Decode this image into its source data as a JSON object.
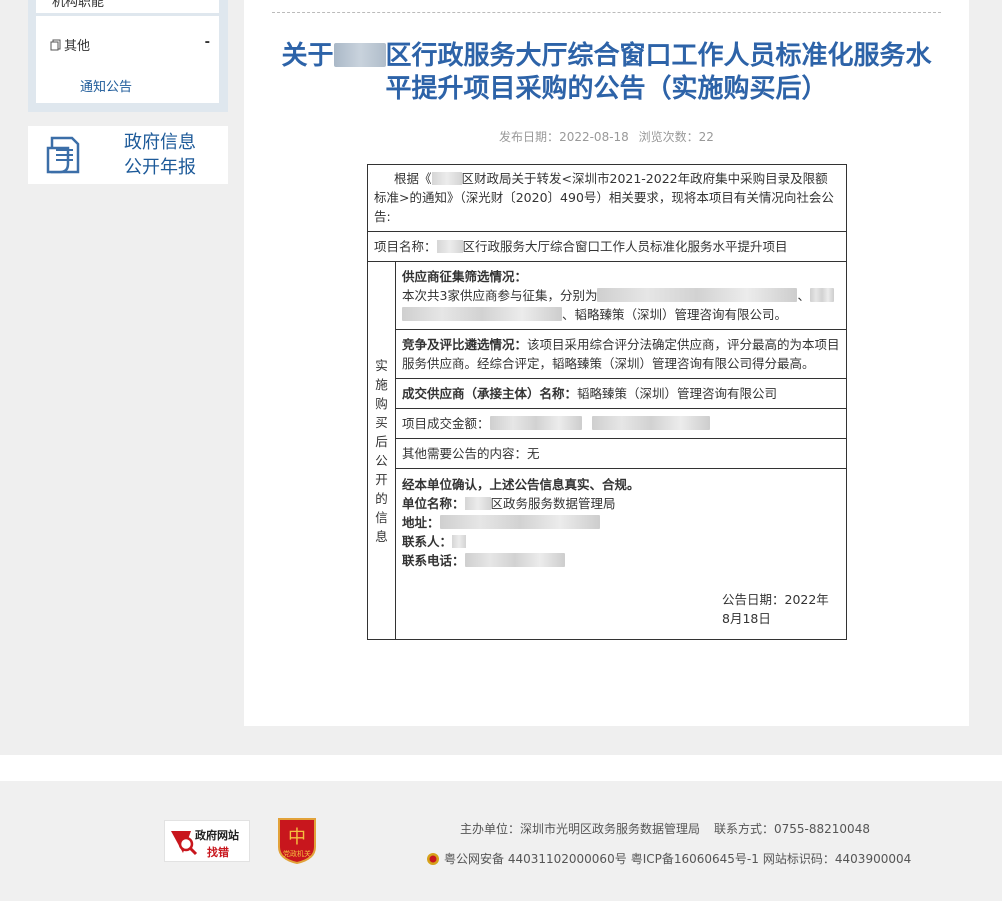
{
  "sidebar": {
    "clipped_item": "机构职能",
    "category": {
      "label": "其他",
      "toggle": "-",
      "items": [
        "通知公告"
      ]
    },
    "report": {
      "line1": "政府信息",
      "line2": "公开年报"
    }
  },
  "article": {
    "title_prefix": "关于",
    "title_rest": "区行政服务大厅综合窗口工作人员标准化服务水平提升项目采购的公告（实施购买后）",
    "meta_date_label": "发布日期：",
    "meta_date": "2022-08-18",
    "meta_views_label": "浏览次数：",
    "meta_views": "22",
    "intro_a": "根据《",
    "intro_b": "区财政局关于转发<深圳市2021-2022年政府集中采购目录及限额标准>的通知》（深光财〔2020〕490号）相关要求，现将本项目有关情况向社会公告:",
    "project_label": "项目名称：",
    "project_name": "区行政服务大厅综合窗口工作人员标准化服务水平提升项目",
    "side_label": [
      "实",
      "施",
      "购",
      "买",
      "后",
      "公",
      "开",
      "的",
      "信",
      "息"
    ],
    "supplier_title": "供应商征集筛选情况：",
    "supplier_text_a": "本次共3家供应商参与征集，分别为",
    "supplier_text_b": "、",
    "supplier_text_c": "、韬略臻策（深圳）管理咨询有限公司。",
    "compete_title": "竞争及评比遴选情况：",
    "compete_text": "该项目采用综合评分法确定供应商，评分最高的为本项目服务供应商。经综合评定，韬略臻策（深圳）管理咨询有限公司得分最高。",
    "winner_title": "成交供应商（承接主体）名称：",
    "winner_name": "韬略臻策（深圳）管理咨询有限公司",
    "amount_label": "项目成交金额：",
    "other_label": "其他需要公告的内容：无",
    "confirm_line": "经本单位确认，上述公告信息真实、合规。",
    "unit_label": "单位名称：",
    "unit_name": "区政务服务数据管理局",
    "address_label": "地址：",
    "contact_label": "联系人：",
    "phone_label": "联系电话：",
    "notice_date": "公告日期：2022年8月18日"
  },
  "footer": {
    "badge1_top": "政府网站",
    "badge1_bottom": "找错",
    "badge2": "党政机关",
    "host": "主办单位：深圳市光明区政务服务数据管理局",
    "contact": "联系方式：0755-88210048",
    "police": "粤公网安备 44031102000060号",
    "icp": "粤ICP备16060645号-1",
    "site_id": "网站标识码：4403900004"
  },
  "colors": {
    "title": "#2d63a8",
    "link": "#1d5a99",
    "badge_red": "#c8161d"
  }
}
